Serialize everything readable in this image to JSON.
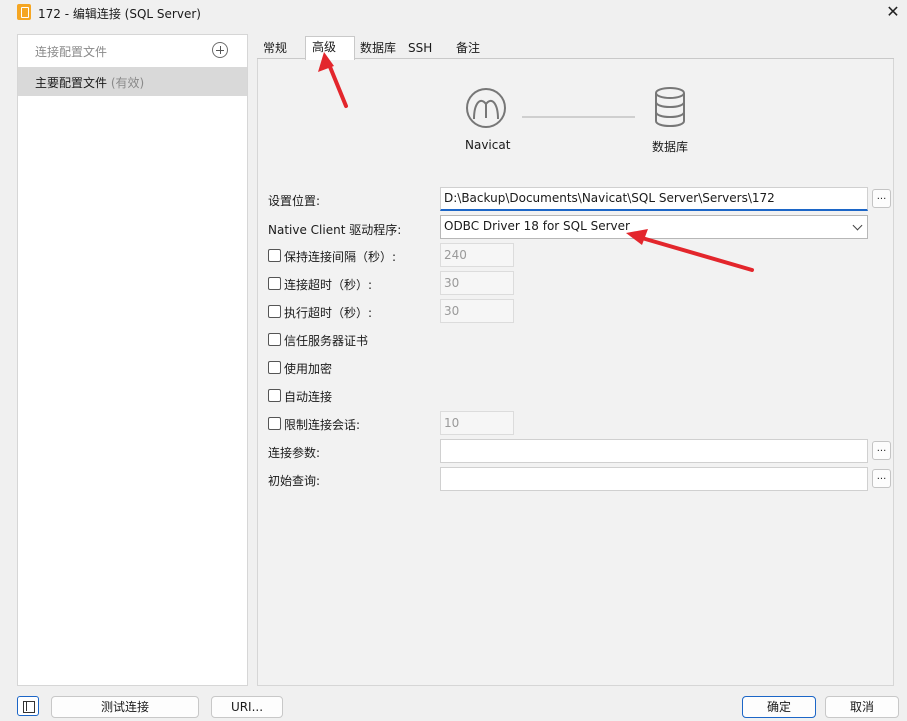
{
  "window": {
    "title": "172 - 编辑连接 (SQL Server)"
  },
  "sidebar": {
    "header_label": "连接配置文件",
    "items": [
      {
        "label": "主要配置文件",
        "tag": "(有效)"
      }
    ]
  },
  "tabs": [
    {
      "label": "常规",
      "active": false
    },
    {
      "label": "高级",
      "active": true
    },
    {
      "label": "数据库",
      "active": false
    },
    {
      "label": "SSH",
      "active": false
    },
    {
      "label": "备注",
      "active": false
    }
  ],
  "diagram": {
    "left_label": "Navicat",
    "right_label": "数据库"
  },
  "form": {
    "location_label": "设置位置:",
    "location_value": "D:\\Backup\\Documents\\Navicat\\SQL Server\\Servers\\172",
    "native_client_label": "Native Client 驱动程序:",
    "native_client_value": "ODBC Driver 18 for SQL Server",
    "keepalive_label": "保持连接间隔（秒）:",
    "keepalive_value": "240",
    "keepalive_checked": false,
    "conn_timeout_label": "连接超时（秒）:",
    "conn_timeout_value": "30",
    "conn_timeout_checked": false,
    "exec_timeout_label": "执行超时（秒）:",
    "exec_timeout_value": "30",
    "exec_timeout_checked": false,
    "trust_cert_label": "信任服务器证书",
    "trust_cert_checked": false,
    "encrypt_label": "使用加密",
    "encrypt_checked": false,
    "auto_connect_label": "自动连接",
    "auto_connect_checked": false,
    "limit_sessions_label": "限制连接会话:",
    "limit_sessions_value": "10",
    "limit_sessions_checked": false,
    "conn_params_label": "连接参数:",
    "conn_params_value": "",
    "init_query_label": "初始查询:",
    "init_query_value": "",
    "dots_label": "..."
  },
  "footer": {
    "test_button": "测试连接",
    "uri_button": "URI...",
    "ok_button": "确定",
    "cancel_button": "取消"
  },
  "colors": {
    "accent": "#1c66c7",
    "annotation_arrow": "#e3262c"
  }
}
